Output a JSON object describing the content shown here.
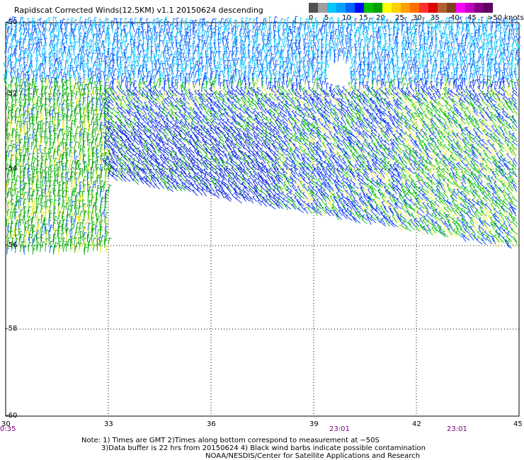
{
  "title": "Rapidscat Corrected Winds(12.5KM) v1.1 20150624 descending",
  "colorbar": {
    "colors": [
      "#505050",
      "#a0a0a0",
      "#00c8ff",
      "#00a0ff",
      "#0064ff",
      "#0000ff",
      "#00c000",
      "#00a000",
      "#ffff00",
      "#ffd000",
      "#ffa000",
      "#ff7000",
      "#ff3030",
      "#e00000",
      "#b06030",
      "#804020",
      "#ff00ff",
      "#c000c0",
      "#800080",
      "#600060"
    ],
    "labels": [
      "0",
      "5",
      "10",
      "15",
      "20",
      "25",
      "30",
      "35",
      "40",
      "45",
      ">50 knots"
    ]
  },
  "lat_labels": [
    "-50",
    "-52",
    "-54",
    "-56",
    "-58",
    "-60"
  ],
  "lon_labels": [
    "30",
    "33",
    "36",
    "39",
    "42",
    "45"
  ],
  "time_labels": [
    "0:35",
    "23:01",
    "23:01"
  ],
  "notes": [
    "Note: 1) Times are GMT 2)Times along bottom correspond to measurement at −50S",
    "3)Data buffer is 22 hrs from 20150624 4) Black wind barbs indicate possible contamination",
    "NOAA/NESDIS/Center for Satellite Applications and Research"
  ]
}
